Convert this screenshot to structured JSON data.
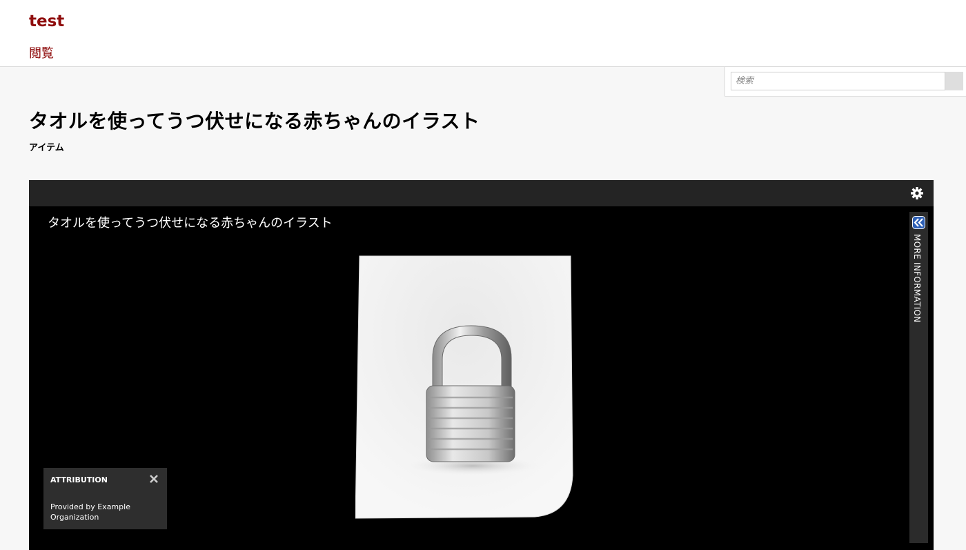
{
  "header": {
    "site_title": "test",
    "nav": {
      "browse_label": "閲覧"
    }
  },
  "search": {
    "placeholder": "検索"
  },
  "page": {
    "title": "タオルを使ってうつ伏せになる赤ちゃんのイラスト",
    "item_type": "アイテム"
  },
  "viewer": {
    "canvas_label": "タオルを使ってうつ伏せになる赤ちゃんのイラスト",
    "more_information_label": "MORE INFORMATION",
    "attribution": {
      "title": "ATTRIBUTION",
      "text": "Provided by Example Organization"
    },
    "icons": {
      "settings": "gear-icon",
      "expand": "chevron-left-double-icon",
      "close": "close-icon",
      "image": "locked-document-icon"
    }
  },
  "colors": {
    "brand": "#8f0d0d",
    "viewer_bg": "#000000",
    "toolbar_bg": "#242424"
  }
}
